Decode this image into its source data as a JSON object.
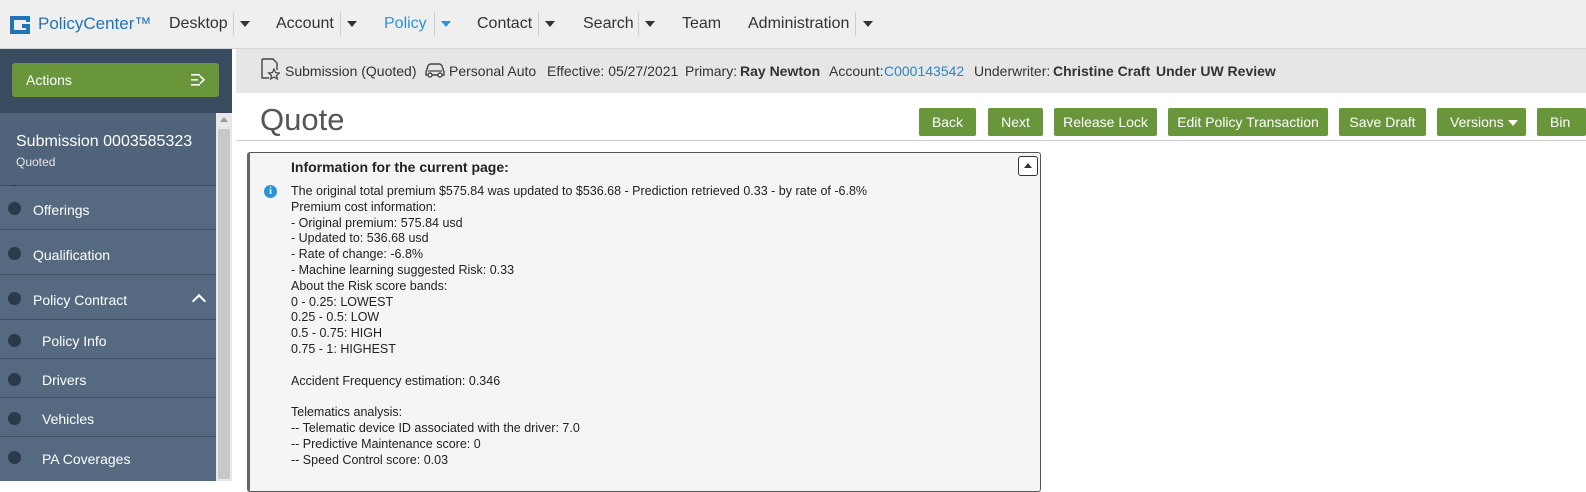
{
  "app": {
    "name": "PolicyCenter™"
  },
  "nav": {
    "items": [
      {
        "label": "Desktop",
        "has_menu": true
      },
      {
        "label": "Account",
        "has_menu": true
      },
      {
        "label": "Policy",
        "has_menu": true,
        "active": true
      },
      {
        "label": "Contact",
        "has_menu": true
      },
      {
        "label": "Search",
        "has_menu": true
      },
      {
        "label": "Team",
        "has_menu": false
      },
      {
        "label": "Administration",
        "has_menu": true
      }
    ]
  },
  "sidebar": {
    "actions_label": "Actions",
    "submission_title": "Submission 0003585323",
    "submission_status": "Quoted",
    "items": [
      {
        "label": "Offerings"
      },
      {
        "label": "Qualification"
      },
      {
        "label": "Policy Contract",
        "expanded": true
      },
      {
        "label": "Policy Info"
      },
      {
        "label": "Drivers"
      },
      {
        "label": "Vehicles"
      },
      {
        "label": "PA Coverages"
      }
    ]
  },
  "infobar": {
    "submission": "Submission (Quoted)",
    "product": "Personal Auto",
    "effective": "Effective: 05/27/2021",
    "primary_label": "Primary:",
    "primary_value": "Ray Newton",
    "account_label": "Account:",
    "account_value": "C000143542",
    "underwriter_label": "Underwriter:",
    "underwriter_value": "Christine Craft",
    "review_status": "Under UW Review"
  },
  "page": {
    "title": "Quote",
    "buttons": {
      "back": "Back",
      "next": "Next",
      "release_lock": "Release Lock",
      "edit_policy_transaction": "Edit Policy Transaction",
      "save_draft": "Save Draft",
      "versions": "Versions",
      "bind": "Bin"
    }
  },
  "panel": {
    "heading": "Information for the current page:",
    "lines": [
      "The original total premium $575.84 was updated to $536.68 - Prediction retrieved 0.33 - by rate of -6.8%",
      "Premium cost information:",
      "- Original premium: 575.84 usd",
      "- Updated to: 536.68 usd",
      "- Rate of change: -6.8%",
      "- Machine learning suggested Risk: 0.33",
      "About the Risk score bands:",
      "0 - 0.25: LOWEST",
      "0.25 - 0.5: LOW",
      "0.5 - 0.75: HIGH",
      "0.75 - 1: HIGHEST",
      "",
      "Accident Frequency estimation: 0.346",
      "",
      "Telematics analysis:",
      "-- Telematic device ID associated with the driver: 7.0",
      "-- Predictive Maintenance score: 0",
      "-- Speed Control score: 0.03"
    ]
  },
  "colors": {
    "button_green": "#69963a",
    "link_blue": "#2b86c5",
    "nav_active": "#2b94d6",
    "sidebar_bg": "#4a5d72"
  }
}
